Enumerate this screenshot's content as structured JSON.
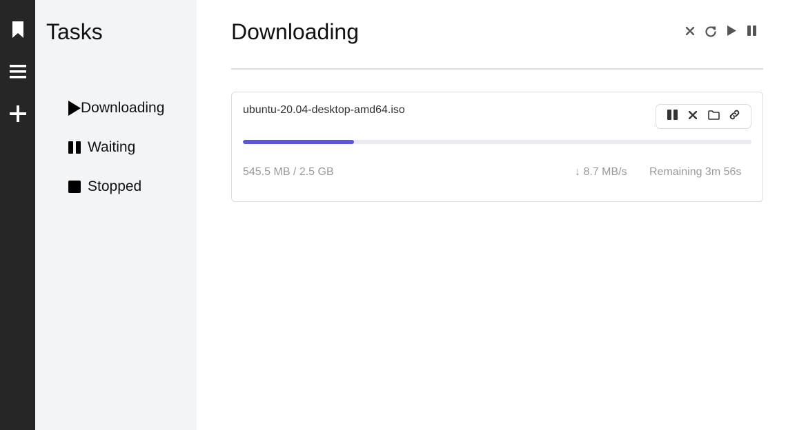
{
  "sidebar": {
    "title": "Tasks",
    "items": [
      {
        "label": "Downloading",
        "icon": "play-icon"
      },
      {
        "label": "Waiting",
        "icon": "pause-icon"
      },
      {
        "label": "Stopped",
        "icon": "stop-icon"
      }
    ]
  },
  "rail": {
    "icons": [
      "bookmark-icon",
      "menu-icon",
      "plus-icon"
    ]
  },
  "main": {
    "title": "Downloading",
    "toolbar": [
      "close-icon",
      "refresh-icon",
      "play-icon",
      "pause-icon"
    ]
  },
  "task": {
    "name": "ubuntu-20.04-desktop-amd64.iso",
    "size": "545.5 MB / 2.5 GB",
    "speed": "↓ 8.7 MB/s",
    "remaining": "Remaining 3m 56s",
    "progress": 0.218,
    "actions": [
      "pause-icon",
      "close-icon",
      "folder-icon",
      "link-icon"
    ]
  },
  "colors": {
    "rail": "#262626",
    "sidebar": "#f3f4f6",
    "accent": "#5b57d6"
  }
}
